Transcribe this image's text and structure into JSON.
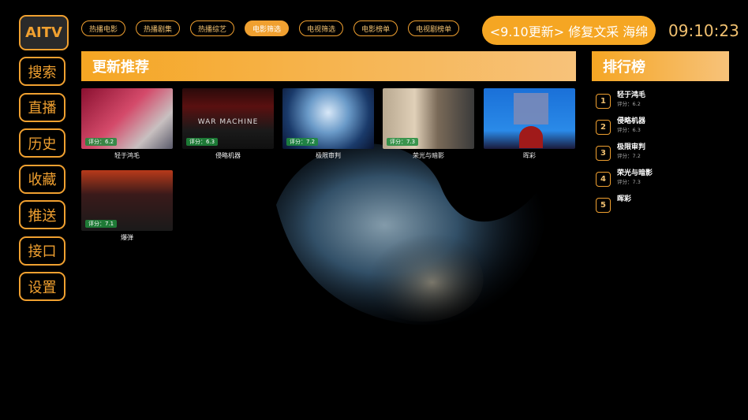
{
  "sidebar": {
    "items": [
      {
        "label": "AITV"
      },
      {
        "label": "搜索"
      },
      {
        "label": "直播"
      },
      {
        "label": "历史"
      },
      {
        "label": "收藏"
      },
      {
        "label": "推送"
      },
      {
        "label": "接口"
      },
      {
        "label": "设置"
      }
    ]
  },
  "tabs": [
    {
      "label": "热播电影"
    },
    {
      "label": "热播剧集"
    },
    {
      "label": "热播综艺"
    },
    {
      "label": "电影筛选"
    },
    {
      "label": "电视筛选"
    },
    {
      "label": "电影榜单"
    },
    {
      "label": "电视剧榜单"
    }
  ],
  "notice": "<9.10更新> 修复文采  海绵",
  "clock": "09:10:23",
  "main": {
    "title": "更新推荐",
    "movies": [
      {
        "title": "轻于鸿毛",
        "rating": "评分：6.2"
      },
      {
        "title": "侵略机器",
        "rating": "评分：6.3",
        "poster_text": "WAR MACHINE"
      },
      {
        "title": "极限审判",
        "rating": "评分：7.2"
      },
      {
        "title": "荣光与暗影",
        "rating": "评分：7.3"
      },
      {
        "title": "晖彩",
        "rating": ""
      },
      {
        "title": "爆弹",
        "rating": "评分：7.1"
      }
    ]
  },
  "ranking": {
    "title": "排行榜",
    "items": [
      {
        "num": "1",
        "name": "轻于鸿毛",
        "score": "评分：6.2"
      },
      {
        "num": "2",
        "name": "侵略机器",
        "score": "评分：6.3"
      },
      {
        "num": "3",
        "name": "极限审判",
        "score": "评分：7.2"
      },
      {
        "num": "4",
        "name": "荣光与暗影",
        "score": "评分：7.3"
      },
      {
        "num": "5",
        "name": "晖彩",
        "score": ""
      }
    ]
  },
  "colors": {
    "accent": "#f5a623",
    "background": "#000000"
  }
}
